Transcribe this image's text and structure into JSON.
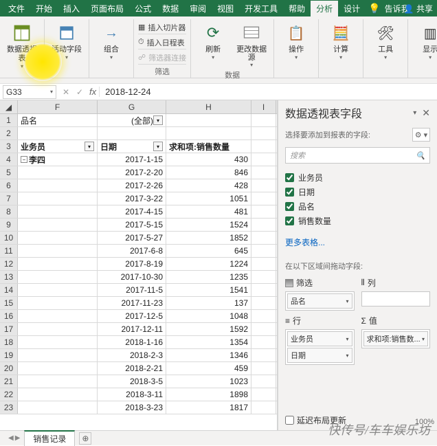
{
  "menubar": {
    "tabs": [
      "文件",
      "开始",
      "插入",
      "页面布局",
      "公式",
      "数据",
      "审阅",
      "视图",
      "开发工具",
      "帮助",
      "分析",
      "设计"
    ],
    "active_index": 10,
    "tellme": "告诉我",
    "share": "共享"
  },
  "ribbon": {
    "pivottable": "数据透视表",
    "active_field": "活动字段",
    "group": "组合",
    "insert_slicer": "插入切片器",
    "insert_timeline": "插入日程表",
    "filter_conn": "筛选器连接",
    "filter_label": "筛选",
    "refresh": "刷新",
    "change_source": "更改数据源",
    "data_label": "数据",
    "actions": "操作",
    "calc": "计算",
    "tools": "工具",
    "show": "显示"
  },
  "formula": {
    "name_box": "G33",
    "value": "2018-12-24"
  },
  "columns": [
    "F",
    "G",
    "H",
    "I"
  ],
  "header_row": {
    "f": "品名",
    "g_value": "(全部)"
  },
  "header_row2": {
    "f": "业务员",
    "g": "日期",
    "h": "求和项:销售数量"
  },
  "group_lisi": "李四",
  "table_rows": [
    {
      "r": 4,
      "g": "2017-1-15",
      "h": "430"
    },
    {
      "r": 5,
      "g": "2017-2-20",
      "h": "846"
    },
    {
      "r": 6,
      "g": "2017-2-26",
      "h": "428"
    },
    {
      "r": 7,
      "g": "2017-3-22",
      "h": "1051"
    },
    {
      "r": 8,
      "g": "2017-4-15",
      "h": "481"
    },
    {
      "r": 9,
      "g": "2017-5-15",
      "h": "1524"
    },
    {
      "r": 10,
      "g": "2017-5-27",
      "h": "1852"
    },
    {
      "r": 11,
      "g": "2017-6-8",
      "h": "645"
    },
    {
      "r": 12,
      "g": "2017-8-19",
      "h": "1224"
    },
    {
      "r": 13,
      "g": "2017-10-30",
      "h": "1235"
    },
    {
      "r": 14,
      "g": "2017-11-5",
      "h": "1541"
    },
    {
      "r": 15,
      "g": "2017-11-23",
      "h": "137"
    },
    {
      "r": 16,
      "g": "2017-12-5",
      "h": "1048"
    },
    {
      "r": 17,
      "g": "2017-12-11",
      "h": "1592"
    },
    {
      "r": 18,
      "g": "2018-1-16",
      "h": "1354"
    },
    {
      "r": 19,
      "g": "2018-2-3",
      "h": "1346"
    },
    {
      "r": 20,
      "g": "2018-2-21",
      "h": "459"
    },
    {
      "r": 21,
      "g": "2018-3-5",
      "h": "1023"
    },
    {
      "r": 22,
      "g": "2018-3-11",
      "h": "1898"
    },
    {
      "r": 23,
      "g": "2018-3-23",
      "h": "1817"
    }
  ],
  "field_pane": {
    "title": "数据透视表字段",
    "subtitle": "选择要添加到报表的字段:",
    "search_placeholder": "搜索",
    "fields": [
      "业务员",
      "日期",
      "品名",
      "销售数量"
    ],
    "more_tables": "更多表格...",
    "areas_label": "在以下区域间拖动字段:",
    "area_filter": "筛选",
    "area_columns": "列",
    "area_rows": "行",
    "area_values": "值",
    "filter_items": [
      "品名"
    ],
    "row_items": [
      "业务员",
      "日期"
    ],
    "value_items": [
      "求和项:销售数..."
    ],
    "defer": "延迟布局更新"
  },
  "sheet": {
    "name": "销售记录"
  },
  "status": {
    "zoom": "100%"
  },
  "watermark": "快传号/车车娱乐坊"
}
